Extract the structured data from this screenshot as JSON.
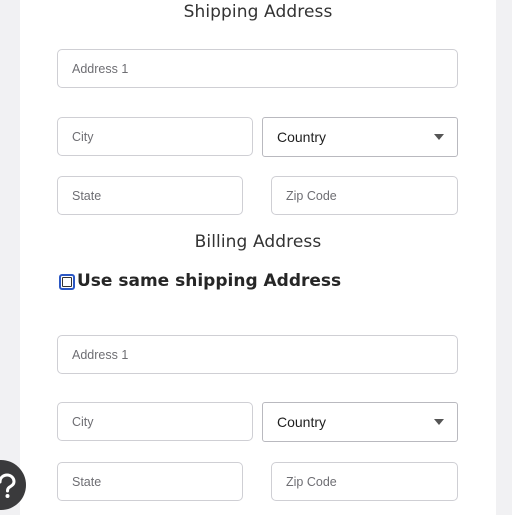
{
  "shipping": {
    "title": "Shipping Address",
    "address1_placeholder": "Address 1",
    "city_placeholder": "City",
    "country_value": "Country",
    "state_placeholder": "State",
    "zip_placeholder": "Zip Code"
  },
  "billing": {
    "title": "Billing Address",
    "same_as_shipping_label": "Use same shipping Address",
    "same_as_shipping_checked": false,
    "address1_placeholder": "Address 1",
    "city_placeholder": "City",
    "country_value": "Country",
    "state_placeholder": "State",
    "zip_placeholder": "Zip Code"
  },
  "icons": {
    "help_fab": "help-icon",
    "select_caret": "caret-down-icon"
  },
  "colors": {
    "checkbox_border": "#2b57c4",
    "page_background": "#f1f1f3",
    "card_background": "#ffffff"
  }
}
